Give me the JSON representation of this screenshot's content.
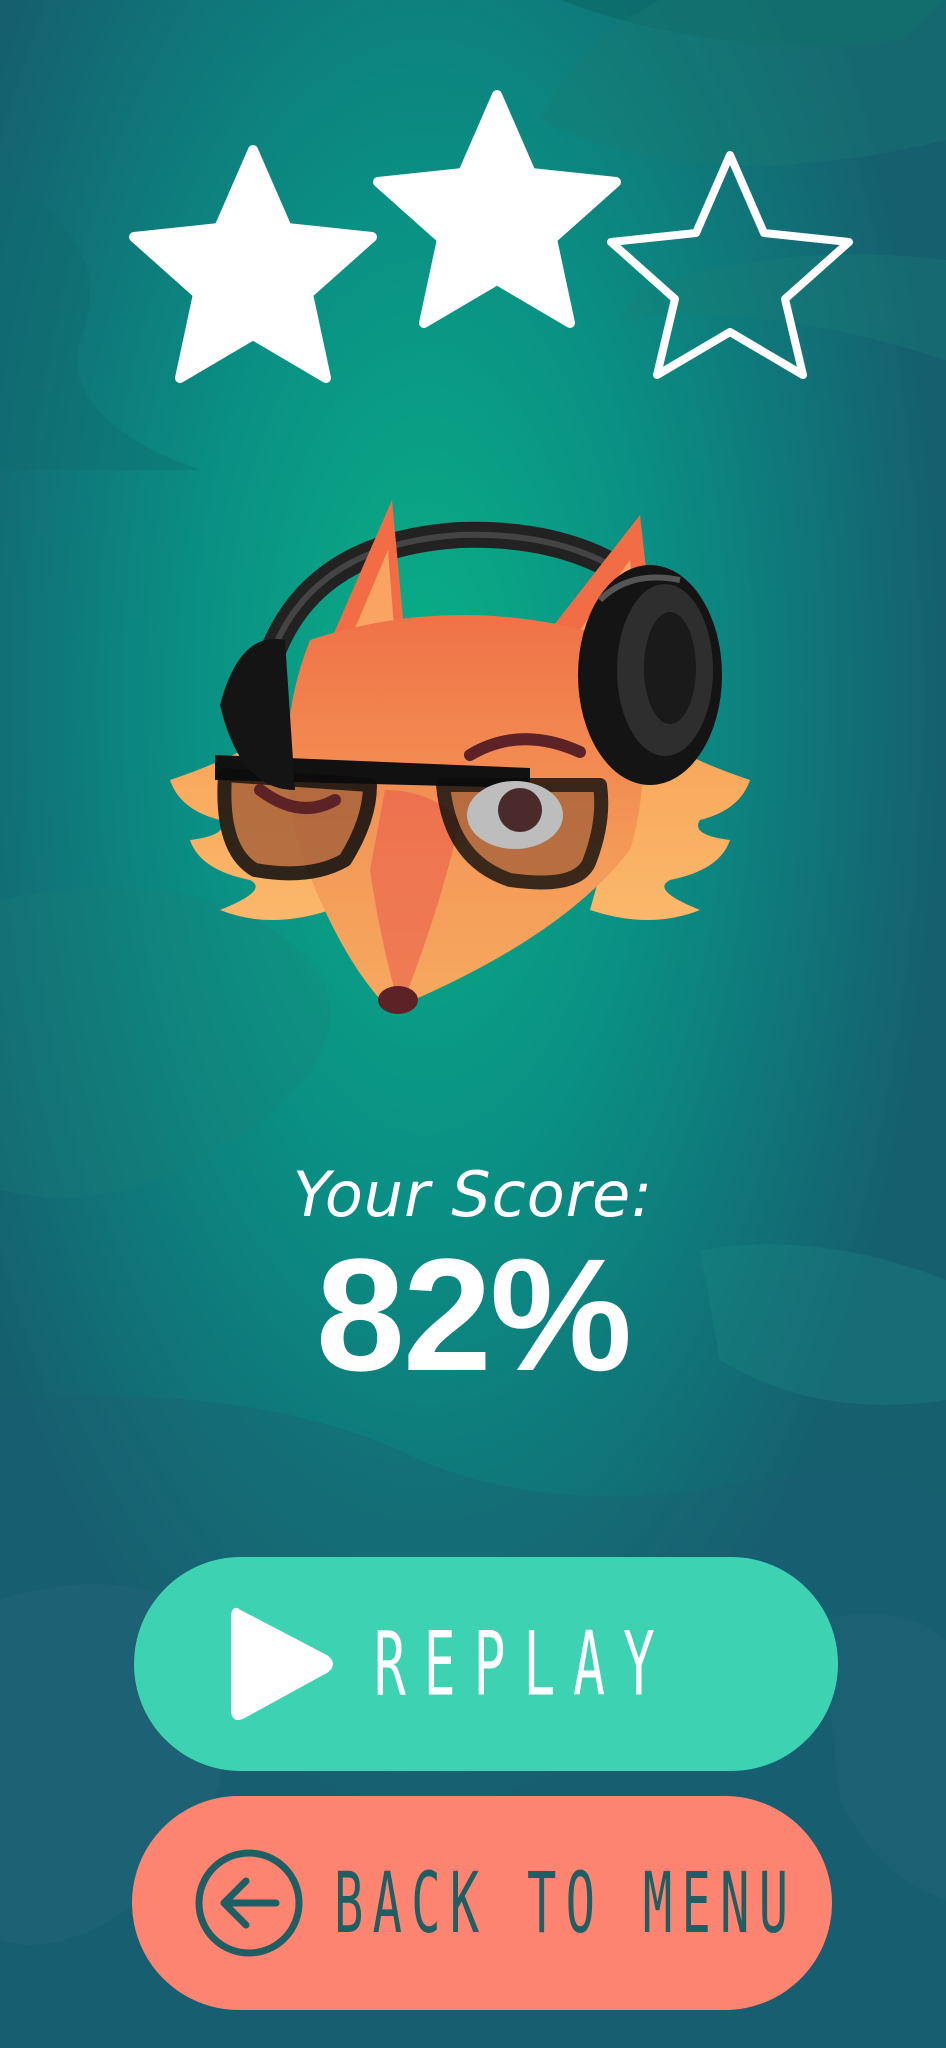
{
  "rating": {
    "filled": 2,
    "total": 3,
    "filled_color": "#ffffff",
    "empty_outline_color": "#ffffff"
  },
  "character": {
    "icon": "fox-with-headphones-and-glasses-icon"
  },
  "score": {
    "label": "Your Score:",
    "value": "82%"
  },
  "buttons": {
    "replay": {
      "label": "REPLAY",
      "icon": "play-icon",
      "color": "#3dd3b2"
    },
    "menu": {
      "label": "BACK TO MENU",
      "icon": "arrow-left-circle-icon",
      "color": "#fe8472"
    }
  },
  "colors": {
    "background": "#0f6f72",
    "accent": "#3dd3b2",
    "secondary": "#fe8472",
    "dark_text": "#1f5f63"
  }
}
